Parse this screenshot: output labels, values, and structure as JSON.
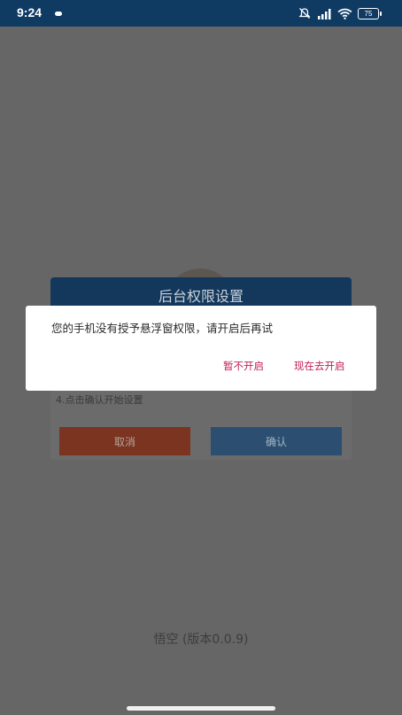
{
  "status_bar": {
    "time": "9:24",
    "battery": "75"
  },
  "background_dialog": {
    "title": "后台权限设置",
    "step_text": "4.点击确认开始设置",
    "cancel_label": "取消",
    "confirm_label": "确认"
  },
  "alert": {
    "message": "您的手机没有授予悬浮窗权限，请开启后再试",
    "deny_label": "暂不开启",
    "allow_label": "现在去开启"
  },
  "footer": {
    "version": "悟空 (版本0.0.9)"
  },
  "colors": {
    "status_bar": "#0f3b63",
    "overlay": "#666666",
    "alert_button": "#c21e5a"
  }
}
